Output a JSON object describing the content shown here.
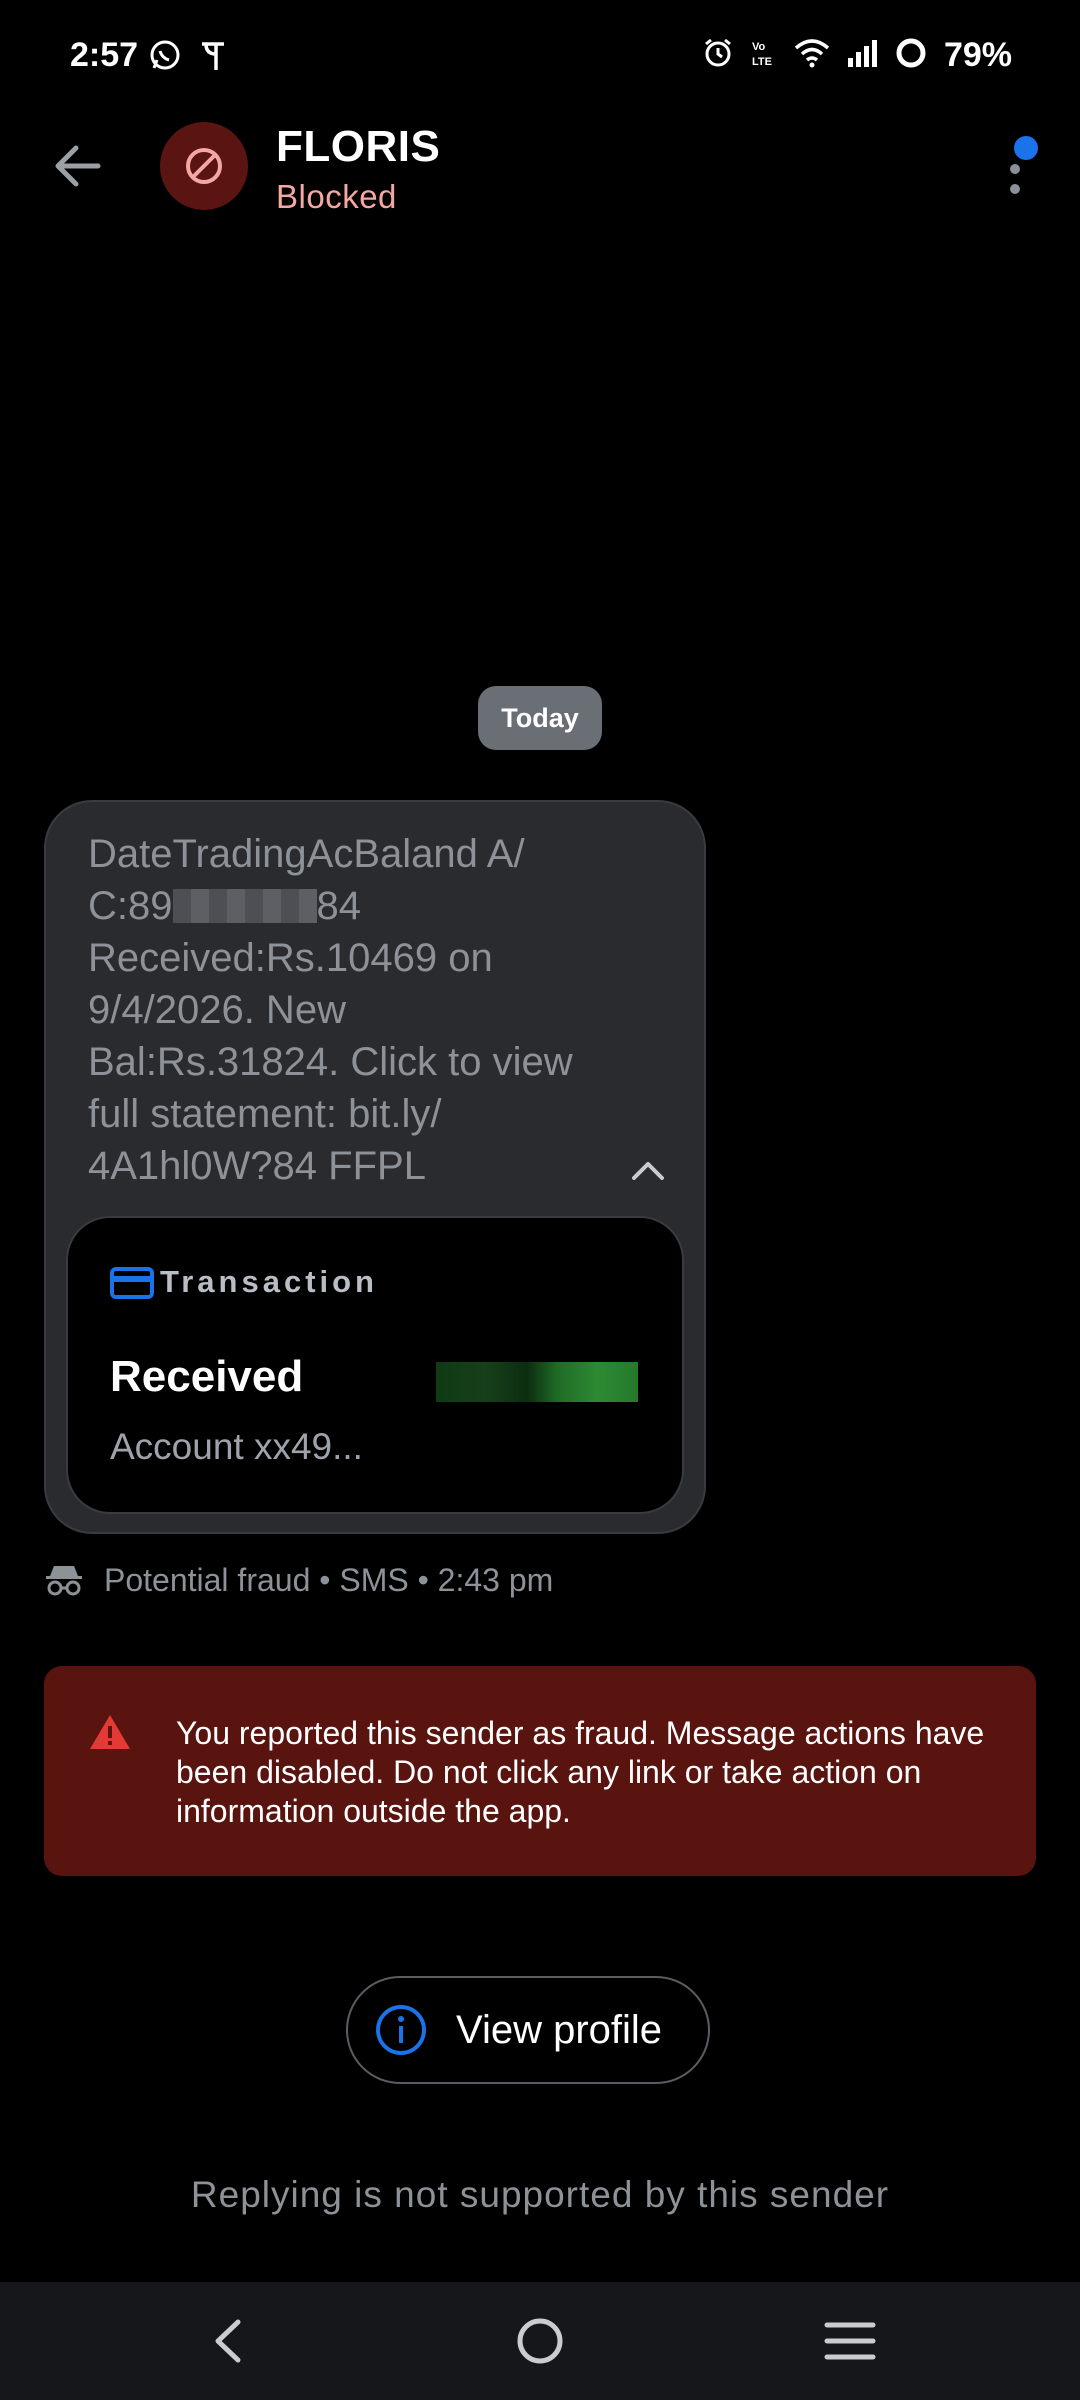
{
  "status_bar": {
    "time": "2:57",
    "battery": "79%",
    "left_icons": [
      "whatsapp-icon",
      "phonepe-icon"
    ],
    "right_icons": [
      "alarm-icon",
      "volte-icon",
      "wifi-icon",
      "signal-icon",
      "battery-ring-icon"
    ]
  },
  "header": {
    "contact_name": "FLORIS",
    "contact_status": "Blocked",
    "avatar_icon": "blocked-icon"
  },
  "conversation": {
    "date_chip": "Today",
    "message": {
      "line1": "DateTradingAcBaland A/",
      "line2_prefix": "C:89",
      "line2_suffix": "84",
      "line3": "Received:Rs.10469 on",
      "line4": "9/4/2026. New",
      "line5": "Bal:Rs.31824. Click to view",
      "line6": "full statement: bit.ly/",
      "line7": "4A1hl0W?84 FFPL"
    },
    "transaction_card": {
      "label": "Transaction",
      "title": "Received",
      "account": "Account xx49..."
    },
    "meta": "Potential fraud • SMS • 2:43 pm"
  },
  "fraud_banner": {
    "text": "You reported this sender as fraud. Message actions have been disabled. Do not click any link or take action on information outside the app."
  },
  "view_profile": {
    "label": "View profile"
  },
  "reply_note": "Replying is not supported by this sender",
  "colors": {
    "background": "#000000",
    "bubble": "#2a2b2f",
    "blocked_avatar": "#5a1412",
    "blocked_text": "#f4a7a3",
    "fraud_banner": "#5a1410",
    "accent_blue": "#1a73e8"
  }
}
